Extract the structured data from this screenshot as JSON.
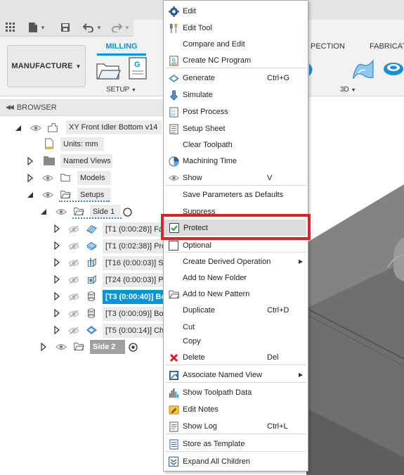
{
  "toolbar": {
    "workspace_label": "MANUFACTURE",
    "active_tab": "MILLING",
    "tab_inspection": "PECTION",
    "tab_fabrication": "FABRICAT",
    "group_setup": "SETUP",
    "group_3d": "3D",
    "accent_color": "#0696d7"
  },
  "browser": {
    "header": "BROWSER",
    "root": "XY Front Idler Bottom v14",
    "units": "Units: mm",
    "named_views": "Named Views",
    "models": "Models",
    "setups": "Setups",
    "side1": "Side 1",
    "ops": [
      {
        "label": "[T1 (0:00:28)] Fa",
        "icon": "face-op-icon",
        "selected": false
      },
      {
        "label": "[T1 (0:02:38)] Pro",
        "icon": "profile-op-icon",
        "selected": false
      },
      {
        "label": "[T16 (0:00:03)] S",
        "icon": "spot-op-icon",
        "selected": false
      },
      {
        "label": "[T24 (0:00:03)] P",
        "icon": "pocket-op-icon",
        "selected": false
      },
      {
        "label": "[T3 (0:00:40)] Bo",
        "icon": "bore-op-icon",
        "selected": true
      },
      {
        "label": "[T3 (0:00:09)] Bo",
        "icon": "bore-op-icon",
        "selected": false
      },
      {
        "label": "[T5 (0:00:14)] Ch",
        "icon": "chamfer-op-icon",
        "selected": false
      }
    ],
    "side2": "Side 2"
  },
  "context_menu": {
    "items": [
      {
        "label": "Edit",
        "icon": "gear-icon"
      },
      {
        "label": "Edit Tool",
        "icon": "tool-icon"
      },
      {
        "label": "Compare and Edit",
        "icon": ""
      },
      {
        "label": "Create NC Program",
        "icon": "nc-program-icon"
      },
      {
        "label": "Generate",
        "icon": "generate-icon",
        "shortcut": "Ctrl+G"
      },
      {
        "label": "Simulate",
        "icon": "simulate-icon"
      },
      {
        "label": "Post Process",
        "icon": "post-process-icon"
      },
      {
        "label": "Setup Sheet",
        "icon": "setup-sheet-icon"
      },
      {
        "label": "Clear Toolpath",
        "icon": ""
      },
      {
        "label": "Machining Time",
        "icon": "machining-time-icon"
      },
      {
        "label": "Show",
        "icon": "eye-icon",
        "shortcut": "V"
      },
      {
        "label": "Save Parameters as Defaults",
        "icon": ""
      },
      {
        "label": "Suppress",
        "icon": ""
      },
      {
        "label": "Protect",
        "icon": "checkbox-checked-icon",
        "checked": true
      },
      {
        "label": "Optional",
        "icon": "checkbox-icon",
        "checked": false
      },
      {
        "label": "Create Derived Operation",
        "icon": "",
        "submenu": true
      },
      {
        "label": "Add to New Folder",
        "icon": ""
      },
      {
        "label": "Add to New Pattern",
        "icon": "folder-pattern-icon"
      },
      {
        "label": "Duplicate",
        "icon": "",
        "shortcut": "Ctrl+D"
      },
      {
        "label": "Cut",
        "icon": ""
      },
      {
        "label": "Copy",
        "icon": ""
      },
      {
        "label": "Delete",
        "icon": "delete-x-icon",
        "shortcut": "Del"
      },
      {
        "label": "Associate Named View",
        "icon": "named-view-icon",
        "submenu": true
      },
      {
        "label": "Show Toolpath Data",
        "icon": "toolpath-data-icon"
      },
      {
        "label": "Edit Notes",
        "icon": "notes-icon"
      },
      {
        "label": "Show Log",
        "icon": "log-icon",
        "shortcut": "Ctrl+L"
      },
      {
        "label": "Store as Template",
        "icon": "template-icon"
      },
      {
        "label": "Expand All Children",
        "icon": "expand-icon"
      }
    ],
    "highlight_color": "#e0202b"
  }
}
